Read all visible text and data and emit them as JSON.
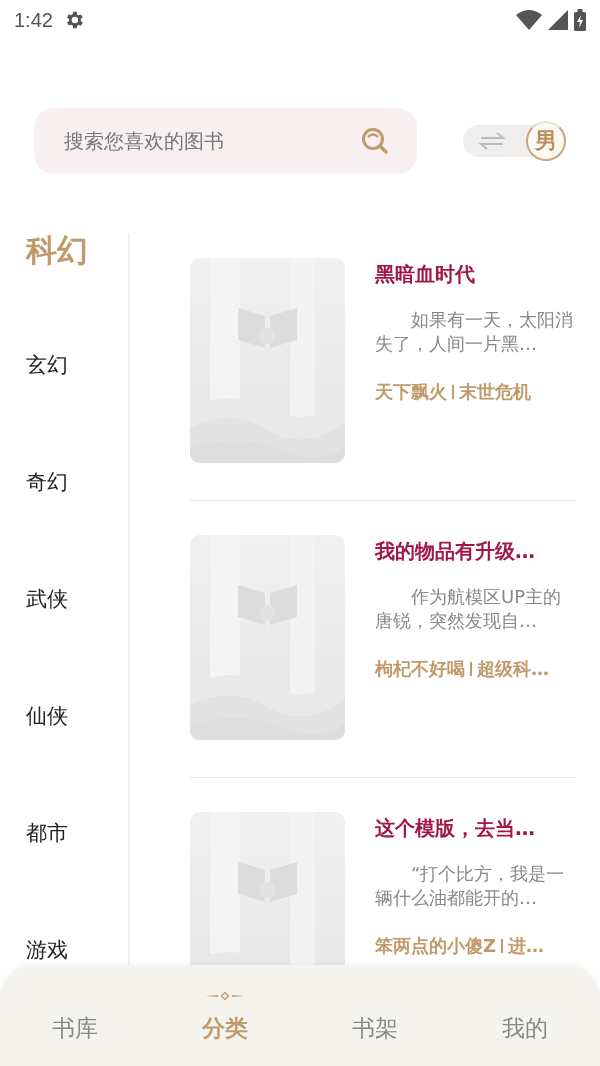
{
  "status_bar": {
    "time": "1:42"
  },
  "search": {
    "placeholder": "搜索您喜欢的图书"
  },
  "gender_toggle": {
    "label": "男",
    "on": true
  },
  "categories": [
    {
      "label": "科幻",
      "selected": true
    },
    {
      "label": "玄幻",
      "selected": false
    },
    {
      "label": "奇幻",
      "selected": false
    },
    {
      "label": "武侠",
      "selected": false
    },
    {
      "label": "仙侠",
      "selected": false
    },
    {
      "label": "都市",
      "selected": false
    },
    {
      "label": "游戏",
      "selected": false
    }
  ],
  "books": [
    {
      "title": "黑暗血时代",
      "summary": "如果有一天，太阳消失了，人间一片黑…",
      "author": "天下飘火",
      "genre": "末世危机"
    },
    {
      "title": "我的物品有升级…",
      "summary": "作为航模区UP主的唐锐，突然发现自…",
      "author": "枸杞不好喝",
      "genre": "超级科…"
    },
    {
      "title": "这个模版，去当…",
      "summary": "“打个比方，我是一辆什么油都能开的…",
      "author": "笨两点的小傻Z",
      "genre": "进…"
    }
  ],
  "tabs": [
    {
      "label": "书库",
      "selected": false
    },
    {
      "label": "分类",
      "selected": true
    },
    {
      "label": "书架",
      "selected": false
    },
    {
      "label": "我的",
      "selected": false
    }
  ]
}
